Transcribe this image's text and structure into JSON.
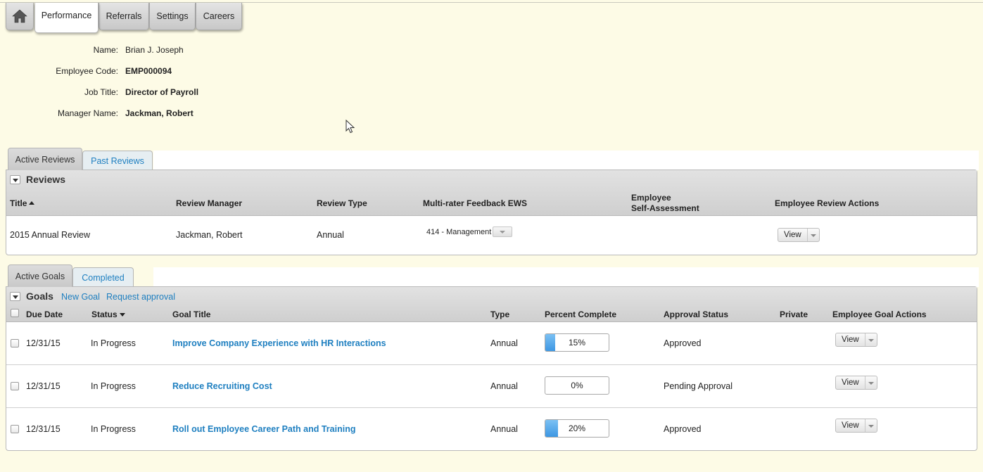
{
  "nav": {
    "home_icon": "home-icon",
    "tabs": [
      {
        "label": "Performance",
        "active": true
      },
      {
        "label": "Referrals",
        "active": false
      },
      {
        "label": "Settings",
        "active": false
      },
      {
        "label": "Careers",
        "active": false
      }
    ]
  },
  "employee": {
    "name_label": "Name:",
    "name": "Brian J. Joseph",
    "code_label": "Employee Code:",
    "code": "EMP000094",
    "job_label": "Job Title:",
    "job": "Director of Payroll",
    "manager_label": "Manager Name:",
    "manager": "Jackman, Robert"
  },
  "review_tabs": [
    {
      "label": "Active Reviews",
      "active": true
    },
    {
      "label": "Past Reviews",
      "active": false
    }
  ],
  "reviews": {
    "title": "Reviews",
    "columns": {
      "title": "Title",
      "manager": "Review Manager",
      "type": "Review Type",
      "feedback": "Multi-rater Feedback EWS",
      "self_line1": "Employee",
      "self_line2": "Self-Assessment",
      "actions": "Employee Review Actions"
    },
    "rows": [
      {
        "title": "2015 Annual Review",
        "manager": "Jackman, Robert",
        "type": "Annual",
        "feedback": "414 - Management",
        "action": "View"
      }
    ]
  },
  "goal_tabs": [
    {
      "label": "Active Goals",
      "active": true
    },
    {
      "label": "Completed",
      "active": false
    }
  ],
  "goals": {
    "title": "Goals",
    "new_goal": "New Goal",
    "request_approval": "Request approval",
    "columns": {
      "due": "Due Date",
      "status": "Status",
      "title": "Goal Title",
      "type": "Type",
      "percent": "Percent Complete",
      "approval": "Approval Status",
      "private": "Private",
      "actions": "Employee Goal Actions"
    },
    "rows": [
      {
        "due": "12/31/15",
        "status": "In Progress",
        "title": "Improve Company Experience with HR Interactions",
        "type": "Annual",
        "percent": 15,
        "percent_label": "15%",
        "approval": "Approved",
        "action": "View"
      },
      {
        "due": "12/31/15",
        "status": "In Progress",
        "title": "Reduce Recruiting Cost",
        "type": "Annual",
        "percent": 0,
        "percent_label": "0%",
        "approval": "Pending Approval",
        "action": "View"
      },
      {
        "due": "12/31/15",
        "status": "In Progress",
        "title": "Roll out Employee Career Path and Training",
        "type": "Annual",
        "percent": 20,
        "percent_label": "20%",
        "approval": "Approved",
        "action": "View"
      }
    ]
  },
  "colors": {
    "background": "#fdfbe6",
    "link": "#1e7fc0",
    "progress_fill": "#3d97e3"
  }
}
